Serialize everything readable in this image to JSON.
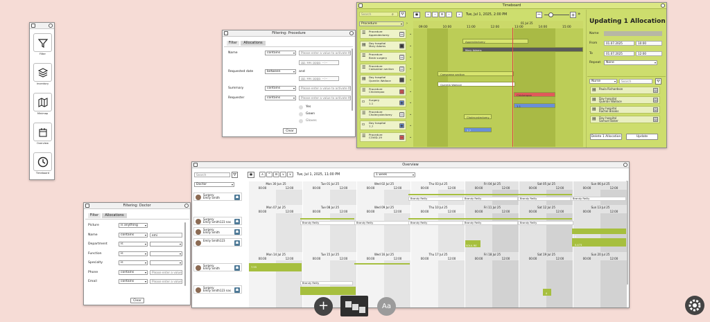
{
  "toolbar": {
    "items": [
      {
        "label": "Filter",
        "icon": "filter-icon"
      },
      {
        "label": "Inventory",
        "icon": "layers-icon"
      },
      {
        "label": "Minimap",
        "icon": "map-icon"
      },
      {
        "label": "Overview",
        "icon": "calendar-icon"
      },
      {
        "label": "Timeboard",
        "icon": "clock-icon"
      }
    ]
  },
  "filter_procedure": {
    "title": "Filtering: Procedure",
    "tabs": [
      "Filter",
      "Allocations"
    ],
    "rows": [
      {
        "label": "Name",
        "op": "contains",
        "placeholder": "Please enter a value to activate th"
      },
      {
        "label": "Requested date",
        "op": "between",
        "date1": "дд. мм. рррр. --:--",
        "and": "and",
        "date2": "дд. мм. рррр. --:--"
      },
      {
        "label": "Summary",
        "op": "contains",
        "placeholder": "Please enter a value to activate th"
      },
      {
        "label": "Requester",
        "op": "contains",
        "placeholder": "Please enter a value to activate th"
      }
    ],
    "radios": [
      "Yes",
      "Gown",
      "Gloves"
    ],
    "clear_label": "Clear"
  },
  "timeboard": {
    "title": "Timeboard",
    "search_placeholder": "Search",
    "group_select": "Procedure",
    "datetime": "Tue, Jul 1, 2025, 2:00 PM",
    "date_header": "01 Jul 25",
    "hours": [
      "09:00",
      "10:00",
      "11:00",
      "12:00",
      "13:00",
      "14:00",
      "15:00"
    ],
    "items": [
      {
        "line1": "Procedure",
        "line2": "Appendectomy",
        "icon": "list-icon",
        "badge": "☷",
        "badge_color": "#ffffff"
      },
      {
        "line1": "Day hospital",
        "line2": "Mary Adams",
        "icon": "bed-icon",
        "badge": "☗",
        "badge_color": "#555555"
      },
      {
        "line1": "Procedure",
        "line2": "Brain surgery",
        "icon": "list-icon",
        "badge": "☷",
        "badge_color": "#ffffff"
      },
      {
        "line1": "Procedure",
        "line2": "Caesarean section",
        "icon": "list-icon",
        "badge": "☷",
        "badge_color": "#ffffff"
      },
      {
        "line1": "Day hospital",
        "line2": "Quentin Wallace",
        "icon": "bed-icon",
        "badge": "▤",
        "badge_color": "#555555"
      },
      {
        "line1": "Procedure",
        "line2": "Chickenpox",
        "icon": "list-icon",
        "badge": "☷",
        "badge_color": "#e05a5a"
      },
      {
        "line1": "Surgery",
        "line2": "1.1",
        "icon": "doc-icon",
        "badge": "◉",
        "badge_color": "#6a8fd8"
      },
      {
        "line1": "Procedure",
        "line2": "Cholecystectomy",
        "icon": "list-icon",
        "badge": "☷",
        "badge_color": "#ffffff"
      },
      {
        "line1": "Day hospital",
        "line2": "7.7",
        "icon": "doc-icon",
        "badge": "◉",
        "badge_color": "#6a8fd8"
      },
      {
        "line1": "Procedure",
        "line2": "COVID-19",
        "icon": "list-icon",
        "badge": "☷",
        "badge_color": "#e05a5a"
      }
    ],
    "bars": [
      {
        "label": "Appendectomy",
        "color": "#d7e46f"
      },
      {
        "label": "Mary Adams",
        "color": "#5a5a5a"
      },
      {
        "label": "Caesarean section",
        "color": "#d7e46f"
      },
      {
        "label": "Quentin Wallace",
        "color": "#ffffff"
      },
      {
        "label": "Chickenpox",
        "color": "#e05a5a"
      },
      {
        "label": "1.1",
        "color": "#6a8fd8"
      },
      {
        "label": "Cholecystectomy",
        "color": "#d7e46f"
      },
      {
        "label": "7.7",
        "color": "#6a8fd8"
      }
    ],
    "panel": {
      "title": "Updating 1 Allocation",
      "name_label": "Name",
      "from_label": "From",
      "from_date": "01.07.2025",
      "from_time": "10:00",
      "to_label": "To",
      "to_date": "01.07.2025",
      "to_time": "12:00",
      "repeat_label": "Repeat",
      "repeat_value": "None",
      "role_select": "Nurse",
      "search_placeholder": "Search",
      "people": [
        {
          "line1": "",
          "line2": "Paula Richardson"
        },
        {
          "line1": "Day hospital",
          "line2": "Quentin Wallace"
        },
        {
          "line1": "Day hospital",
          "line2": "Rachel Brooks"
        },
        {
          "line1": "Day hospital",
          "line2": "Samuel Baker"
        }
      ],
      "delete_label": "Delete 1 Allocation",
      "update_label": "Update"
    }
  },
  "overview": {
    "title": "Overview",
    "search_placeholder": "Search",
    "datetime": "Tue, Jul 1, 2025, 11:00 PM",
    "range_select": "1 week",
    "group_select": "Doctor",
    "weeks": [
      {
        "days": [
          "Mon 30 Jun 25",
          "Tue 01 Jul 25",
          "Wed 02 Jul 25",
          "Thu 03 Jul 25",
          "Fri 04 Jul 25",
          "Sat 05 Jul 25",
          "Sun 06 Jul 25"
        ]
      },
      {
        "days": [
          "Mon 07 Jul 25",
          "Tue 08 Jul 25",
          "Wed 09 Jul 25",
          "Thu 10 Jul 25",
          "Fri 11 Jul 25",
          "Sat 12 Jul 25",
          "Sun 13 Jul 25"
        ]
      },
      {
        "days": [
          "Mon 14 Jul 25",
          "Tue 15 Jul 25",
          "Wed 16 Jul 25",
          "Thu 17 Jul 25",
          "Fri 18 Jul 25",
          "Sat 19 Jul 25",
          "Sun 20 Jul 25"
        ]
      }
    ],
    "time_a": "00:00",
    "time_b": "12:00",
    "rows": [
      {
        "line1": "Surgery",
        "line2": "Emily Smith"
      },
      {
        "line1": "Surgery",
        "line2": "Emily Smith123 nas"
      },
      {
        "line1": "Surgery",
        "line2": "Emily Smith"
      },
      {
        "line1": "",
        "line2": "Emily Smith123"
      },
      {
        "line1": "Surgery",
        "line2": "Emily Smith"
      },
      {
        "line1": "Surgery",
        "line2": "Emily Smith123 nas"
      }
    ],
    "bar_label": "Brandy Reilly",
    "extra_labels": [
      "SOUL RE",
      "0",
      "0.473",
      "7.55",
      "0"
    ]
  },
  "filter_doctor": {
    "title": "Filtering: Doctor",
    "tabs": [
      "Filter",
      "Allocations"
    ],
    "rows": [
      {
        "label": "Picture",
        "op": "is anything"
      },
      {
        "label": "Name",
        "op": "contains",
        "value": "emi"
      },
      {
        "label": "Department",
        "op": "is"
      },
      {
        "label": "Function",
        "op": "is"
      },
      {
        "label": "Specialty",
        "op": "is"
      },
      {
        "label": "Phone",
        "op": "contains",
        "placeholder": "Please enter a value"
      },
      {
        "label": "Email",
        "op": "contains",
        "placeholder": "Please enter a value"
      }
    ],
    "clear_label": "Clear"
  },
  "bottom": {
    "add_label": "+",
    "text_label": "Aa"
  }
}
